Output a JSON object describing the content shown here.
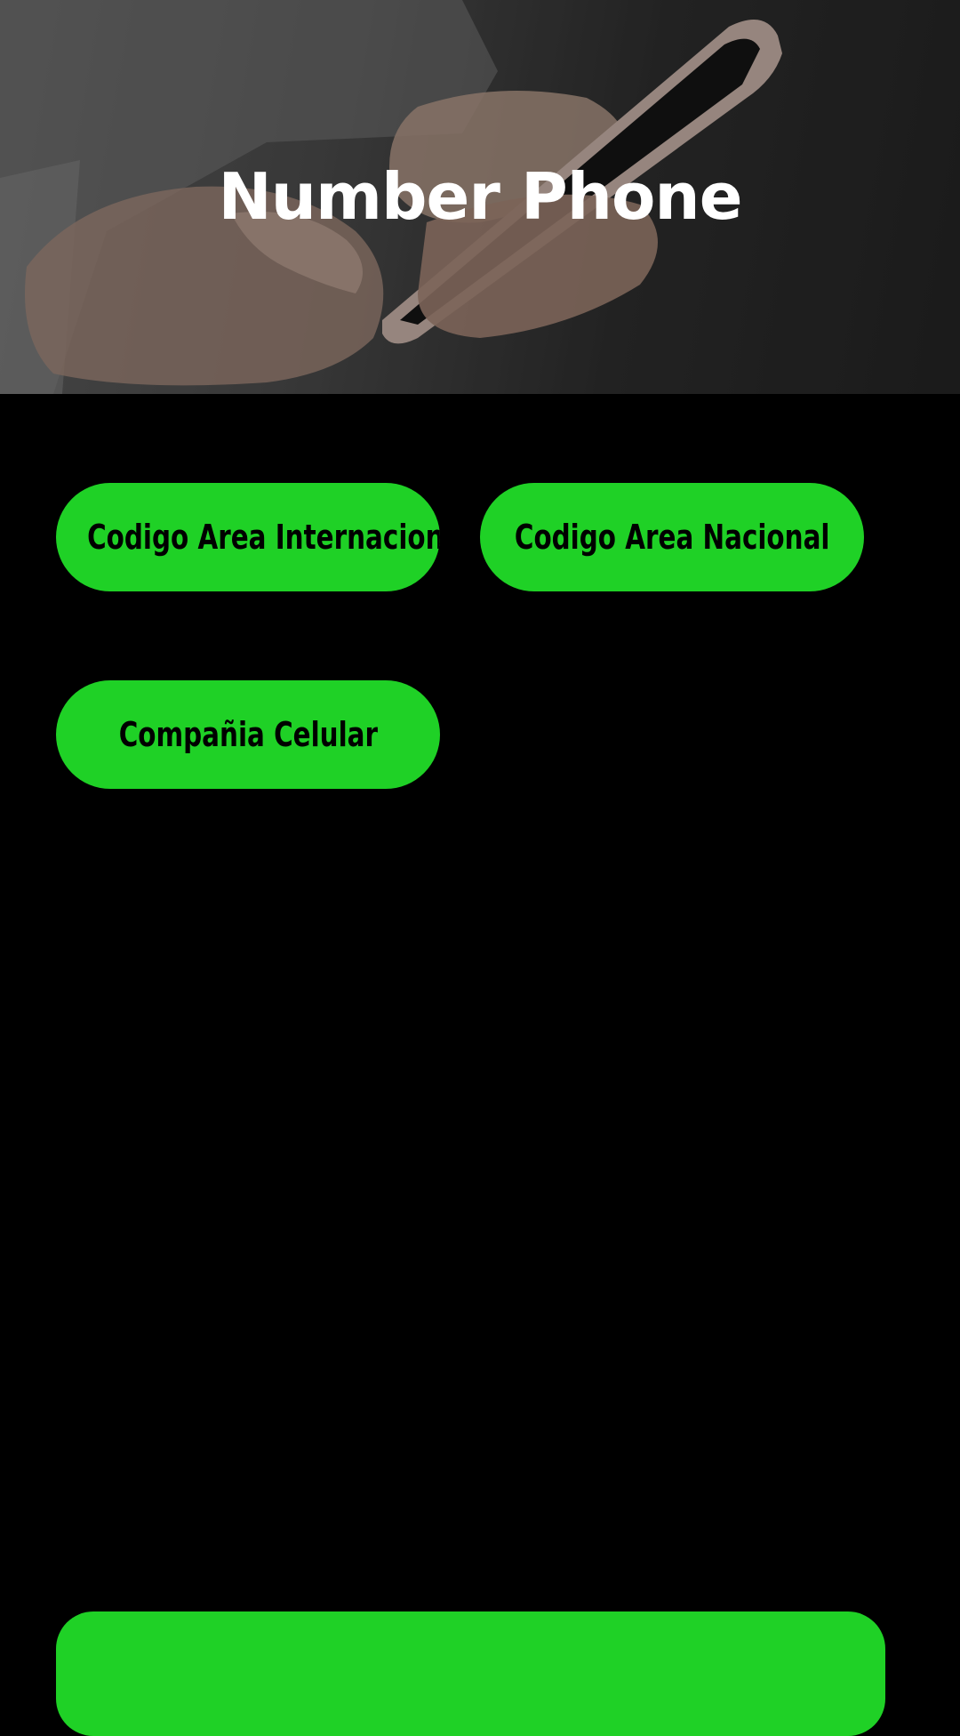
{
  "header": {
    "title": "Number Phone"
  },
  "actions": {
    "codigo_area_internacional": "Codigo Area Internacional",
    "codigo_area_nacional": "Codigo Area Nacional",
    "compania_celular": "Compañia Celular"
  },
  "colors": {
    "background": "#000000",
    "accent": "#1fd126",
    "button_text": "#000000",
    "title_text": "#ffffff"
  }
}
